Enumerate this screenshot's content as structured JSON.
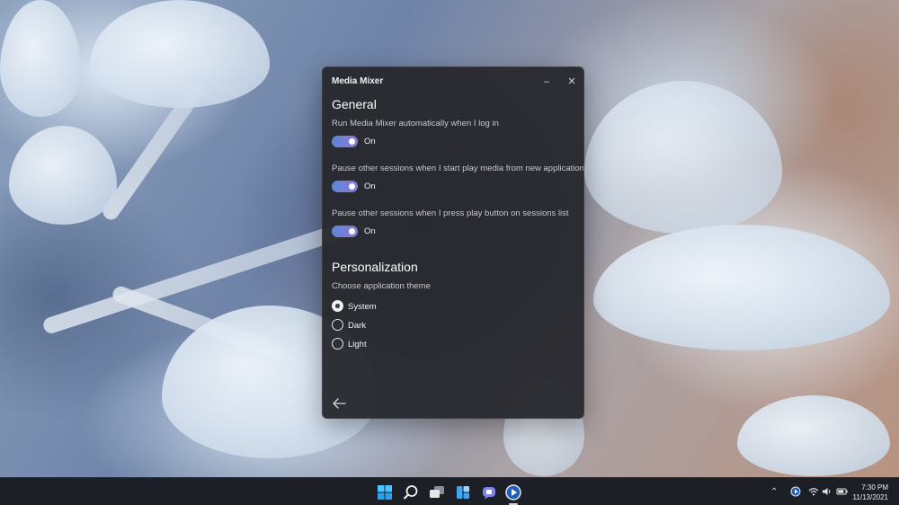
{
  "window": {
    "title": "Media Mixer",
    "minimize_glyph": "–",
    "close_glyph": "✕"
  },
  "general": {
    "heading": "General",
    "settings": [
      {
        "label": "Run Media Mixer automatically when I log in",
        "state": "On"
      },
      {
        "label": "Pause other sessions when I start play media from new application",
        "state": "On"
      },
      {
        "label": "Pause other sessions when I press play button on sessions list",
        "state": "On"
      }
    ]
  },
  "personalization": {
    "heading": "Personalization",
    "theme_label": "Choose application theme",
    "options": [
      "System",
      "Dark",
      "Light"
    ],
    "selected": "System"
  },
  "icons": {
    "back": "back-arrow-icon",
    "taskbar": [
      "windows-start-icon",
      "search-icon",
      "task-view-icon",
      "widgets-icon",
      "teams-chat-icon",
      "media-mixer-icon"
    ],
    "tray": [
      "chevron-up-icon",
      "media-mixer-tray-icon",
      "wifi-icon",
      "volume-icon",
      "battery-icon"
    ]
  },
  "colors": {
    "toggle_start": "#5d86d6",
    "toggle_end": "#8c78d9",
    "window_bg": "#28292e",
    "taskbar_bg": "#1c1f26"
  },
  "taskbar": {
    "time": "7:30 PM",
    "date": "11/13/2021"
  }
}
